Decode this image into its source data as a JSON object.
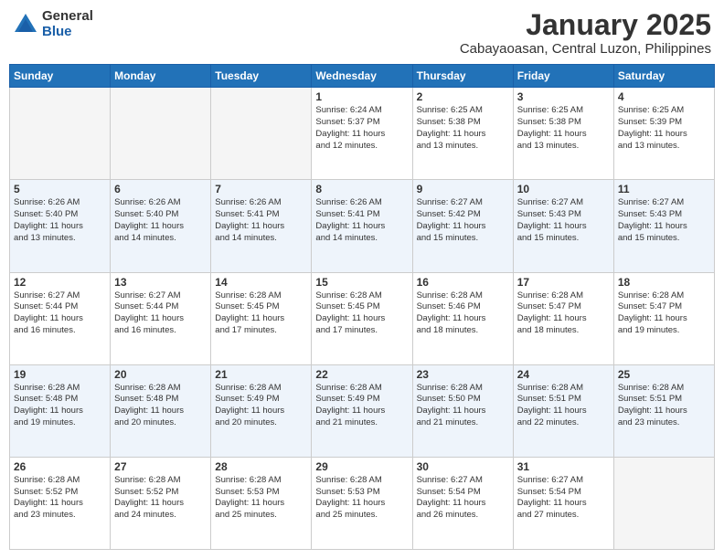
{
  "header": {
    "logo_general": "General",
    "logo_blue": "Blue",
    "main_title": "January 2025",
    "subtitle": "Cabayaoasan, Central Luzon, Philippines"
  },
  "days_of_week": [
    "Sunday",
    "Monday",
    "Tuesday",
    "Wednesday",
    "Thursday",
    "Friday",
    "Saturday"
  ],
  "weeks": [
    {
      "alt": false,
      "days": [
        {
          "num": "",
          "info": ""
        },
        {
          "num": "",
          "info": ""
        },
        {
          "num": "",
          "info": ""
        },
        {
          "num": "1",
          "info": "Sunrise: 6:24 AM\nSunset: 5:37 PM\nDaylight: 11 hours\nand 12 minutes."
        },
        {
          "num": "2",
          "info": "Sunrise: 6:25 AM\nSunset: 5:38 PM\nDaylight: 11 hours\nand 13 minutes."
        },
        {
          "num": "3",
          "info": "Sunrise: 6:25 AM\nSunset: 5:38 PM\nDaylight: 11 hours\nand 13 minutes."
        },
        {
          "num": "4",
          "info": "Sunrise: 6:25 AM\nSunset: 5:39 PM\nDaylight: 11 hours\nand 13 minutes."
        }
      ]
    },
    {
      "alt": true,
      "days": [
        {
          "num": "5",
          "info": "Sunrise: 6:26 AM\nSunset: 5:40 PM\nDaylight: 11 hours\nand 13 minutes."
        },
        {
          "num": "6",
          "info": "Sunrise: 6:26 AM\nSunset: 5:40 PM\nDaylight: 11 hours\nand 14 minutes."
        },
        {
          "num": "7",
          "info": "Sunrise: 6:26 AM\nSunset: 5:41 PM\nDaylight: 11 hours\nand 14 minutes."
        },
        {
          "num": "8",
          "info": "Sunrise: 6:26 AM\nSunset: 5:41 PM\nDaylight: 11 hours\nand 14 minutes."
        },
        {
          "num": "9",
          "info": "Sunrise: 6:27 AM\nSunset: 5:42 PM\nDaylight: 11 hours\nand 15 minutes."
        },
        {
          "num": "10",
          "info": "Sunrise: 6:27 AM\nSunset: 5:43 PM\nDaylight: 11 hours\nand 15 minutes."
        },
        {
          "num": "11",
          "info": "Sunrise: 6:27 AM\nSunset: 5:43 PM\nDaylight: 11 hours\nand 15 minutes."
        }
      ]
    },
    {
      "alt": false,
      "days": [
        {
          "num": "12",
          "info": "Sunrise: 6:27 AM\nSunset: 5:44 PM\nDaylight: 11 hours\nand 16 minutes."
        },
        {
          "num": "13",
          "info": "Sunrise: 6:27 AM\nSunset: 5:44 PM\nDaylight: 11 hours\nand 16 minutes."
        },
        {
          "num": "14",
          "info": "Sunrise: 6:28 AM\nSunset: 5:45 PM\nDaylight: 11 hours\nand 17 minutes."
        },
        {
          "num": "15",
          "info": "Sunrise: 6:28 AM\nSunset: 5:45 PM\nDaylight: 11 hours\nand 17 minutes."
        },
        {
          "num": "16",
          "info": "Sunrise: 6:28 AM\nSunset: 5:46 PM\nDaylight: 11 hours\nand 18 minutes."
        },
        {
          "num": "17",
          "info": "Sunrise: 6:28 AM\nSunset: 5:47 PM\nDaylight: 11 hours\nand 18 minutes."
        },
        {
          "num": "18",
          "info": "Sunrise: 6:28 AM\nSunset: 5:47 PM\nDaylight: 11 hours\nand 19 minutes."
        }
      ]
    },
    {
      "alt": true,
      "days": [
        {
          "num": "19",
          "info": "Sunrise: 6:28 AM\nSunset: 5:48 PM\nDaylight: 11 hours\nand 19 minutes."
        },
        {
          "num": "20",
          "info": "Sunrise: 6:28 AM\nSunset: 5:48 PM\nDaylight: 11 hours\nand 20 minutes."
        },
        {
          "num": "21",
          "info": "Sunrise: 6:28 AM\nSunset: 5:49 PM\nDaylight: 11 hours\nand 20 minutes."
        },
        {
          "num": "22",
          "info": "Sunrise: 6:28 AM\nSunset: 5:49 PM\nDaylight: 11 hours\nand 21 minutes."
        },
        {
          "num": "23",
          "info": "Sunrise: 6:28 AM\nSunset: 5:50 PM\nDaylight: 11 hours\nand 21 minutes."
        },
        {
          "num": "24",
          "info": "Sunrise: 6:28 AM\nSunset: 5:51 PM\nDaylight: 11 hours\nand 22 minutes."
        },
        {
          "num": "25",
          "info": "Sunrise: 6:28 AM\nSunset: 5:51 PM\nDaylight: 11 hours\nand 23 minutes."
        }
      ]
    },
    {
      "alt": false,
      "days": [
        {
          "num": "26",
          "info": "Sunrise: 6:28 AM\nSunset: 5:52 PM\nDaylight: 11 hours\nand 23 minutes."
        },
        {
          "num": "27",
          "info": "Sunrise: 6:28 AM\nSunset: 5:52 PM\nDaylight: 11 hours\nand 24 minutes."
        },
        {
          "num": "28",
          "info": "Sunrise: 6:28 AM\nSunset: 5:53 PM\nDaylight: 11 hours\nand 25 minutes."
        },
        {
          "num": "29",
          "info": "Sunrise: 6:28 AM\nSunset: 5:53 PM\nDaylight: 11 hours\nand 25 minutes."
        },
        {
          "num": "30",
          "info": "Sunrise: 6:27 AM\nSunset: 5:54 PM\nDaylight: 11 hours\nand 26 minutes."
        },
        {
          "num": "31",
          "info": "Sunrise: 6:27 AM\nSunset: 5:54 PM\nDaylight: 11 hours\nand 27 minutes."
        },
        {
          "num": "",
          "info": ""
        }
      ]
    }
  ]
}
